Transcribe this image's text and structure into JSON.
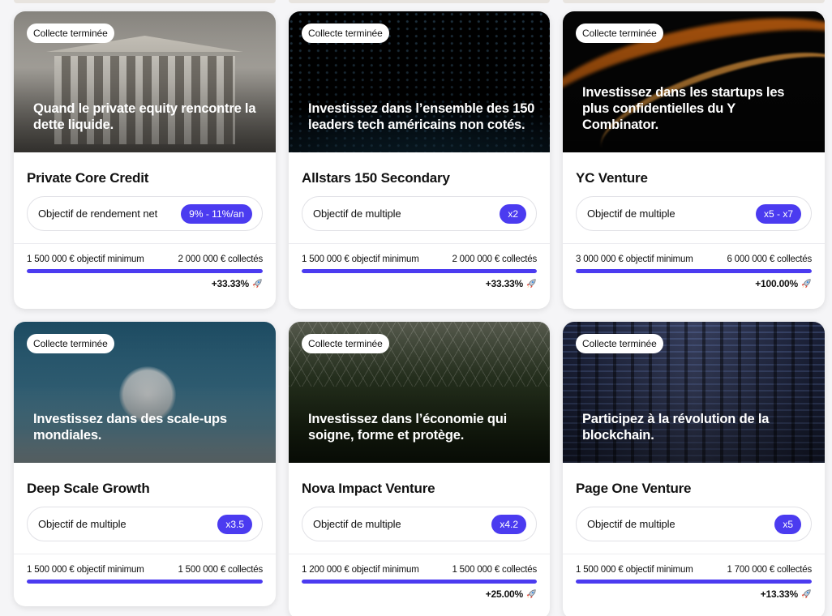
{
  "colors": {
    "accent": "#4b3bf0",
    "card_bg": "#ffffff",
    "page_bg": "#f5f5f7"
  },
  "cards": [
    {
      "badge": "Collecte terminée",
      "headline": "Quand le private equity rencontre la dette liquide.",
      "name": "Private Core Credit",
      "objective_label": "Objectif de rendement net",
      "objective_value": "9% - 11%/an",
      "minimum_amount": "1 500 000 €",
      "minimum_label": "objectif minimum",
      "collected_amount": "2 000 000 €",
      "collected_label": "collectés",
      "progress": 1.0,
      "growth": "+33.33%",
      "growth_icon": "rocket-icon"
    },
    {
      "badge": "Collecte terminée",
      "headline": "Investissez dans l’ensemble des 150 leaders tech américains non cotés.",
      "name": "Allstars 150 Secondary",
      "objective_label": "Objectif de multiple",
      "objective_value": "x2",
      "minimum_amount": "1 500 000 €",
      "minimum_label": "objectif minimum",
      "collected_amount": "2 000 000 €",
      "collected_label": "collectés",
      "progress": 1.0,
      "growth": "+33.33%",
      "growth_icon": "rocket-icon"
    },
    {
      "badge": "Collecte terminée",
      "headline": "Investissez dans les startups les plus confidentielles du Y Combinator.",
      "name": "YC Venture",
      "objective_label": "Objectif de multiple",
      "objective_value": "x5 - x7",
      "minimum_amount": "3 000 000 €",
      "minimum_label": "objectif minimum",
      "collected_amount": "6 000 000 €",
      "collected_label": "collectés",
      "progress": 1.0,
      "growth": "+100.00%",
      "growth_icon": "rocket-icon"
    },
    {
      "badge": "Collecte terminée",
      "headline": "Investissez dans des scale-ups mondiales.",
      "name": "Deep Scale Growth",
      "objective_label": "Objectif de multiple",
      "objective_value": "x3.5",
      "minimum_amount": "1 500 000 €",
      "minimum_label": "objectif minimum",
      "collected_amount": "1 500 000 €",
      "collected_label": "collectés",
      "progress": 1.0,
      "growth": "",
      "growth_icon": ""
    },
    {
      "badge": "Collecte terminée",
      "headline": "Investissez dans l’économie qui soigne, forme et protège.",
      "name": "Nova Impact Venture",
      "objective_label": "Objectif de multiple",
      "objective_value": "x4.2",
      "minimum_amount": "1 200 000 €",
      "minimum_label": "objectif minimum",
      "collected_amount": "1 500 000 €",
      "collected_label": "collectés",
      "progress": 1.0,
      "growth": "+25.00%",
      "growth_icon": "rocket-icon"
    },
    {
      "badge": "Collecte terminée",
      "headline": "Participez à la révolution de la blockchain.",
      "name": "Page One Venture",
      "objective_label": "Objectif de multiple",
      "objective_value": "x5",
      "minimum_amount": "1 500 000 €",
      "minimum_label": "objectif minimum",
      "collected_amount": "1 700 000 €",
      "collected_label": "collectés",
      "progress": 1.0,
      "growth": "+13.33%",
      "growth_icon": "rocket-icon"
    }
  ]
}
